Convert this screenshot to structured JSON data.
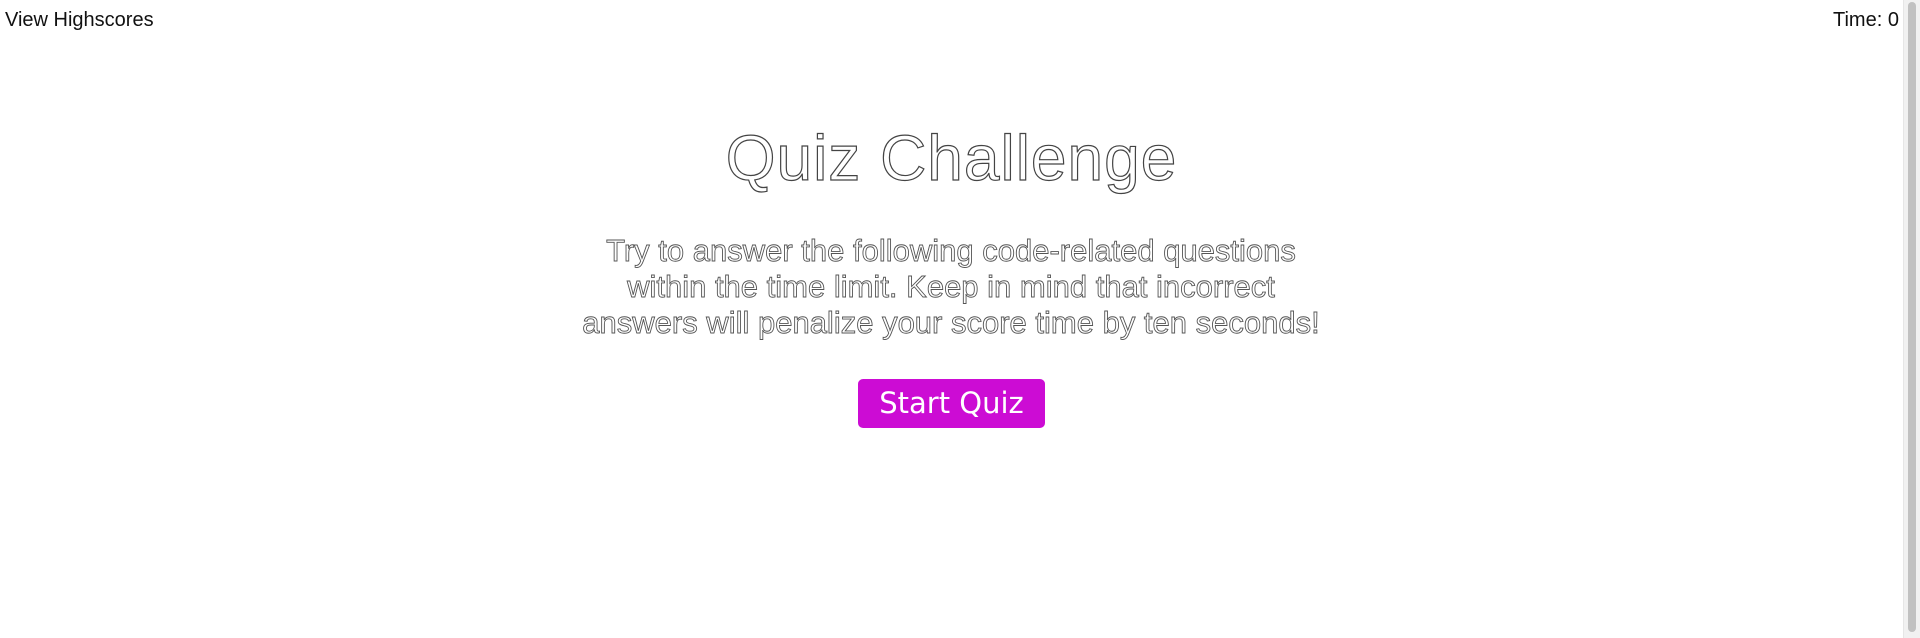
{
  "header": {
    "highscores_link": "View Highscores",
    "timer_label": "Time:",
    "timer_value": "0"
  },
  "main": {
    "title": "Quiz Challenge",
    "instructions": "Try to answer the following code-related questions within the time limit. Keep in mind that incorrect answers will penalize your score time by ten seconds!",
    "start_button": "Start Quiz"
  },
  "colors": {
    "accent": "#cc0cd4",
    "background": "#ffffff"
  }
}
